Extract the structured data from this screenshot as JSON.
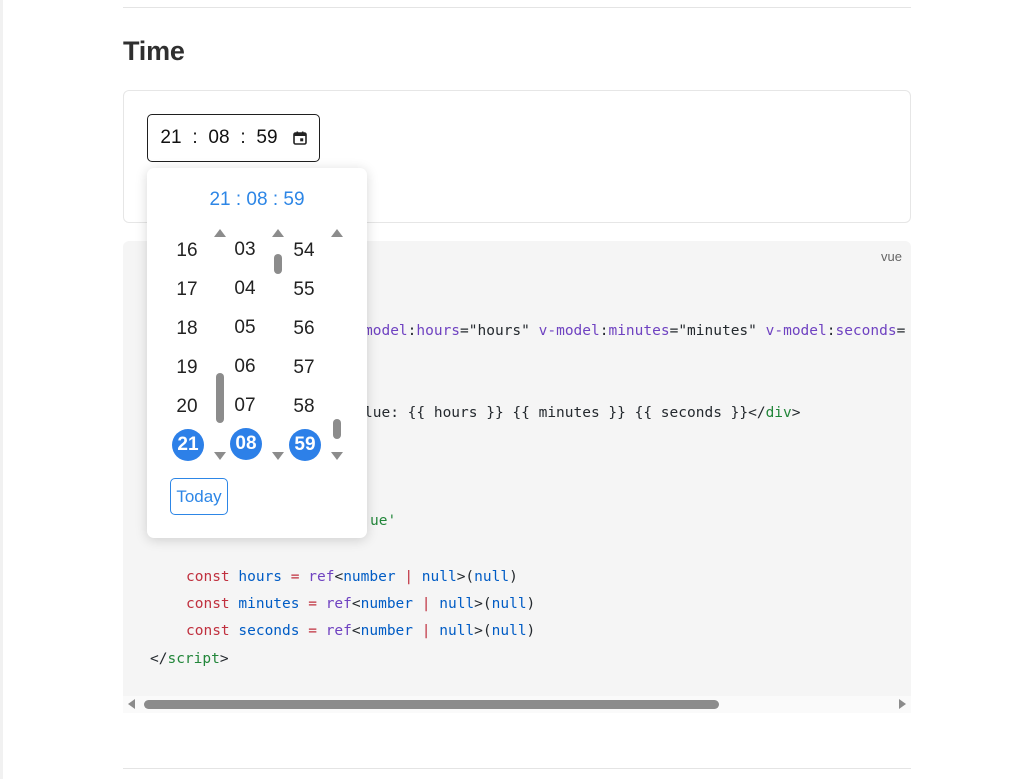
{
  "section": {
    "title": "Time"
  },
  "time_input": {
    "hours": "21",
    "minutes": "08",
    "seconds": "59",
    "sep": ":",
    "icon": "calendar-icon"
  },
  "picker": {
    "header": {
      "hours": "21",
      "minutes": "08",
      "seconds": "59",
      "sep": ":"
    },
    "hours": [
      "16",
      "17",
      "18",
      "19",
      "20",
      "21"
    ],
    "minutes": [
      "03",
      "04",
      "05",
      "06",
      "07",
      "08"
    ],
    "seconds": [
      "54",
      "55",
      "56",
      "57",
      "58",
      "59"
    ],
    "selected": {
      "hours": "21",
      "minutes": "08",
      "seconds": "59"
    },
    "today_label": "Today",
    "accent_color": "#2d80e8"
  },
  "code": {
    "lang": "vue",
    "line_template_attrs": {
      "tail": "model",
      "h_attr": "hours",
      "h_val": "\"hours\"",
      "vm2": "v-model",
      "m_attr": "minutes",
      "m_val": "\"minutes\"",
      "vm3": "v-model",
      "s_attr": "seconds",
      "tail2": "="
    },
    "line_div": {
      "pre": "lue: {{ hours }} {{ minutes }} {{ seconds }}</",
      "tag": "div",
      "post": ">"
    },
    "line_import_tail": "ue'",
    "decl": [
      {
        "kw": "const",
        "name": "hours",
        "eq": "=",
        "fn": "ref",
        "lt": "<",
        "type": "number",
        "bar": "|",
        "null1": "null",
        "gt": ">(",
        "null2": "null",
        "close": ")"
      },
      {
        "kw": "const",
        "name": "minutes",
        "eq": "=",
        "fn": "ref",
        "lt": "<",
        "type": "number",
        "bar": "|",
        "null1": "null",
        "gt": ">(",
        "null2": "null",
        "close": ")"
      },
      {
        "kw": "const",
        "name": "seconds",
        "eq": "=",
        "fn": "ref",
        "lt": "<",
        "type": "number",
        "bar": "|",
        "null1": "null",
        "gt": ">(",
        "null2": "null",
        "close": ")"
      }
    ],
    "close_script": {
      "open": "</",
      "tag": "script",
      "close": ">"
    }
  }
}
